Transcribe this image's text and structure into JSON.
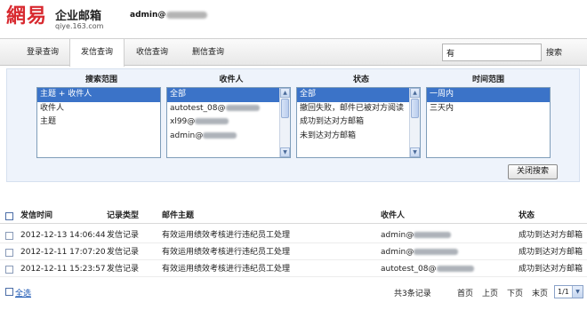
{
  "header": {
    "logo_text": "網易",
    "product_title": "企业邮箱",
    "product_sub": "qiye.163.com",
    "account_prefix": "admin@"
  },
  "tabs": [
    {
      "label": "登录查询",
      "active": false
    },
    {
      "label": "发信查询",
      "active": true
    },
    {
      "label": "收信查询",
      "active": false
    },
    {
      "label": "删信查询",
      "active": false
    }
  ],
  "search": {
    "value": "有",
    "button_label": "搜索"
  },
  "filters": {
    "scope": {
      "title": "搜索范围",
      "options": [
        "主题 + 收件人",
        "收件人",
        "主题"
      ],
      "selected_index": 0
    },
    "recipient": {
      "title": "收件人",
      "options": [
        "全部",
        "autotest_08@",
        "xl99@",
        "admin@"
      ],
      "selected_index": 0
    },
    "status": {
      "title": "状态",
      "options": [
        "全部",
        "撤回失败，邮件已被对方阅读",
        "成功到达对方邮箱",
        "未到达对方邮箱"
      ],
      "selected_index": 0
    },
    "time_range": {
      "title": "时间范围",
      "options": [
        "一周内",
        "三天内"
      ],
      "selected_index": 0
    },
    "close_button_label": "关闭搜索"
  },
  "table": {
    "columns": [
      "发信时间",
      "记录类型",
      "邮件主题",
      "收件人",
      "状态"
    ],
    "rows": [
      {
        "time": "2012-12-13 14:06:44",
        "type": "发信记录",
        "subject": "有效运用绩效考核进行违纪员工处理",
        "recipient": "admin@",
        "status": "成功到达对方邮箱"
      },
      {
        "time": "2012-12-11 17:07:20",
        "type": "发信记录",
        "subject": "有效运用绩效考核进行违纪员工处理",
        "recipient": "admin@",
        "status": "成功到达对方邮箱"
      },
      {
        "time": "2012-12-11 15:23:57",
        "type": "发信记录",
        "subject": "有效运用绩效考核进行违纪员工处理",
        "recipient": "autotest_08@",
        "status": "成功到达对方邮箱"
      }
    ]
  },
  "footer": {
    "select_all_label": "全选",
    "total_label": "共3条记录",
    "first_page": "首页",
    "prev_page": "上页",
    "next_page": "下页",
    "last_page": "末页",
    "page_value": "1/1"
  }
}
